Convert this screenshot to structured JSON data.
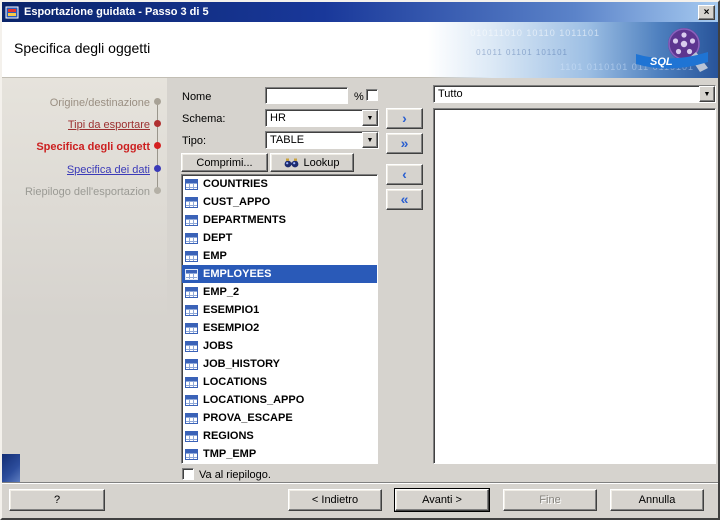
{
  "window": {
    "title": "Esportazione guidata - Passo 3 di 5",
    "close": "×"
  },
  "header": {
    "title": "Specifica degli oggetti",
    "logo_text": "SQL",
    "digits1": "010111010 10110 1011101",
    "digits2": "1101 0110101 011 0110101",
    "digits3": "01011 01101 101101"
  },
  "steps": [
    {
      "label": "Origine/destinazione",
      "state": "inactive"
    },
    {
      "label": "Tipi da esportare",
      "state": "visited"
    },
    {
      "label": "Specifica degli oggett",
      "state": "current"
    },
    {
      "label": "Specifica dei dati",
      "state": "link"
    },
    {
      "label": "Riepilogo dell'esportazion",
      "state": "future"
    }
  ],
  "form": {
    "nome_label": "Nome",
    "nome_value": "",
    "percent_label": "%",
    "schema_label": "Schema:",
    "schema_value": "HR",
    "tipo_label": "Tipo:",
    "tipo_value": "TABLE",
    "comprimi_label": "Comprimi...",
    "lookup_label": "Lookup",
    "goto_summary_label": "Va al riepilogo."
  },
  "transfer": {
    "right": "›",
    "right_all": "»",
    "left": "‹",
    "left_all": "«"
  },
  "objects": [
    "COUNTRIES",
    "CUST_APPO",
    "DEPARTMENTS",
    "DEPT",
    "EMP",
    "EMPLOYEES",
    "EMP_2",
    "ESEMPIO1",
    "ESEMPIO2",
    "JOBS",
    "JOB_HISTORY",
    "LOCATIONS",
    "LOCATIONS_APPO",
    "PROVA_ESCAPE",
    "REGIONS",
    "TMP_EMP"
  ],
  "selected_object": "EMPLOYEES",
  "right_panel": {
    "filter_value": "Tutto"
  },
  "footer": {
    "help_label": "?",
    "back_label": "< Indietro",
    "next_label": "Avanti >",
    "finish_label": "Fine",
    "cancel_label": "Annulla"
  },
  "colors": {
    "titlebar_start": "#0a246a",
    "titlebar_end": "#a6caf0",
    "selection": "#2a5ab8",
    "dialog_bg": "#d6d3ce"
  }
}
